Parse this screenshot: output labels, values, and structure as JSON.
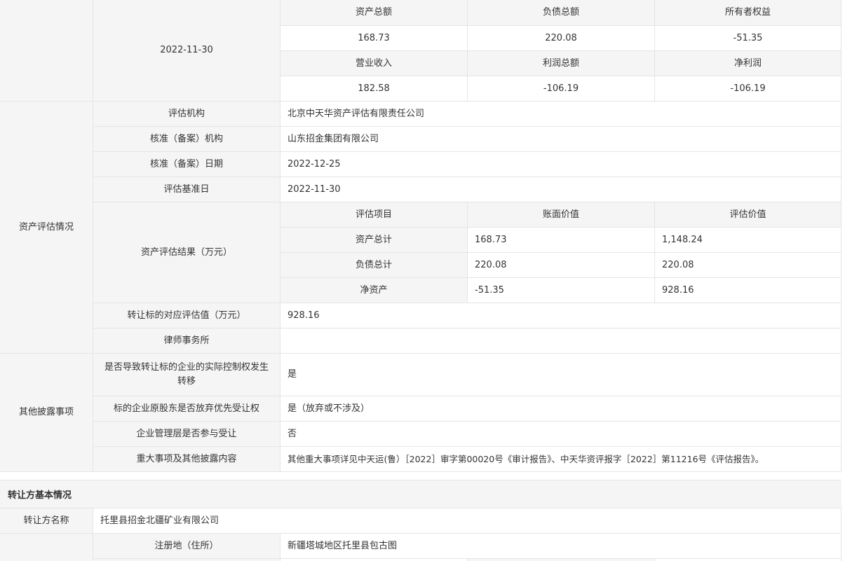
{
  "financials": {
    "date": "2022-11-30",
    "h1": [
      "资产总额",
      "负债总额",
      "所有者权益"
    ],
    "v1": [
      "168.73",
      "220.08",
      "-51.35"
    ],
    "h2": [
      "营业收入",
      "利润总额",
      "净利润"
    ],
    "v2": [
      "182.58",
      "-106.19",
      "-106.19"
    ]
  },
  "asset_eval": {
    "section_label": "资产评估情况",
    "rows": [
      {
        "label": "评估机构",
        "value": "北京中天华资产评估有限责任公司"
      },
      {
        "label": "核准（备案）机构",
        "value": "山东招金集团有限公司"
      },
      {
        "label": "核准（备案）日期",
        "value": "2022-12-25"
      },
      {
        "label": "评估基准日",
        "value": "2022-11-30"
      }
    ],
    "result_label": "资产评估结果（万元）",
    "result_header": [
      "评估项目",
      "账面价值",
      "评估价值"
    ],
    "result_rows": [
      [
        "资产总计",
        "168.73",
        "1,148.24"
      ],
      [
        "负债总计",
        "220.08",
        "220.08"
      ],
      [
        "净资产",
        "-51.35",
        "928.16"
      ]
    ],
    "target_value_label": "转让标的对应评估值（万元）",
    "target_value": "928.16",
    "law_firm_label": "律师事务所",
    "law_firm_value": ""
  },
  "other_disclosure": {
    "section_label": "其他披露事项",
    "rows": [
      {
        "label": "是否导致转让标的企业的实际控制权发生转移",
        "value": "是"
      },
      {
        "label": "标的企业原股东是否放弃优先受让权",
        "value": "是（放弃或不涉及）"
      },
      {
        "label": "企业管理层是否参与受让",
        "value": "否"
      },
      {
        "label": "重大事项及其他披露内容",
        "value": "其他重大事项详见中天运(鲁）［2022］审字第00020号《审计报告》、中天华资评报字［2022］第11216号《评估报告》。"
      }
    ]
  },
  "transferor": {
    "title": "转让方基本情况",
    "name_label": "转让方名称",
    "name_value": "托里县招金北疆矿业有限公司",
    "reg_label": "注册地（住所）",
    "reg_value": "新疆塔城地区托里县包古图"
  }
}
